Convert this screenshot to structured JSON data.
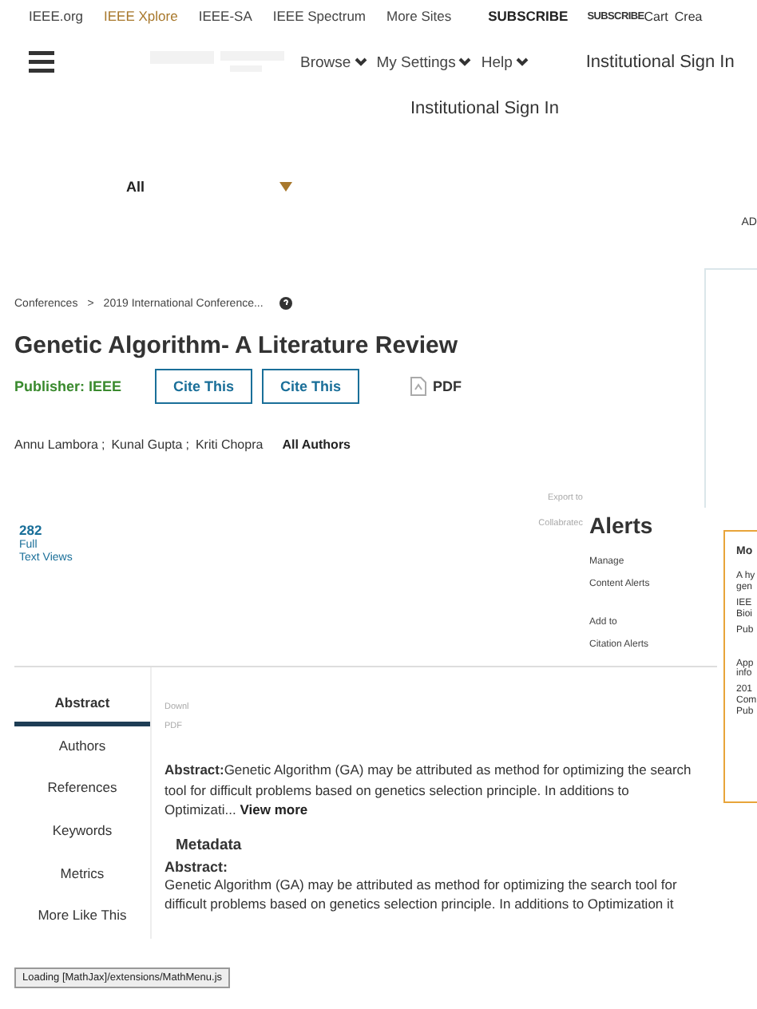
{
  "top_links": [
    {
      "label": "IEEE.org",
      "selected": false
    },
    {
      "label": "IEEE Xplore",
      "selected": true
    },
    {
      "label": "IEEE-SA",
      "selected": false
    },
    {
      "label": "IEEE Spectrum",
      "selected": false
    },
    {
      "label": "More Sites",
      "selected": false
    }
  ],
  "subscribe": "SUBSCRIBE",
  "top_right": [
    "SUBSCRIBE",
    "Cart",
    "Crea"
  ],
  "nav_menus": [
    "Browse",
    "My Settings",
    "Help"
  ],
  "sign_in": "Institutional Sign In",
  "sign_in_second": "Institutional Sign In",
  "search_scope": "All",
  "ad_label": "AD",
  "breadcrumbs": [
    "Conferences",
    "2019 International Conference..."
  ],
  "breadcrumb_separator": ">",
  "title": "Genetic Algorithm- A Literature Review",
  "publisher": "Publisher:  IEEE",
  "cite_buttons": [
    "Cite This",
    "Cite This"
  ],
  "pdf": "PDF",
  "authors": [
    "Annu Lambora",
    "Kunal Gupta",
    "Kriti Chopra"
  ],
  "author_separator": ";",
  "all_authors": "All Authors",
  "views": {
    "count": "282",
    "label_1": "Full",
    "label_2": "Text Views"
  },
  "export": [
    "Export to",
    "Collabratec"
  ],
  "alerts": {
    "title": "Alerts",
    "items": [
      "Manage",
      "Content Alerts",
      "Add to",
      "Citation Alerts"
    ]
  },
  "side_card": {
    "title": "Mo",
    "lines": [
      "A hy",
      "gen",
      "IEE",
      "Bioi",
      "Pub",
      "App",
      "info",
      "201",
      "Com",
      "Pub"
    ]
  },
  "tabs": [
    {
      "label": "Abstract",
      "selected": true
    },
    {
      "label": "Authors",
      "selected": false
    },
    {
      "label": "References",
      "selected": false
    },
    {
      "label": "Keywords",
      "selected": false
    },
    {
      "label": "Metrics",
      "selected": false
    },
    {
      "label": "More Like This",
      "selected": false
    }
  ],
  "download": [
    "Downl",
    "PDF"
  ],
  "abstract_teaser": "**Abstract:**Genetic Algorithm (GA) may be attributed as method for optimizing the search tool for difficult problems based on genetics selection principle. In additions to Optimizati...",
  "view_more": "View more",
  "metadata_heading": "Metadata",
  "abstract_heading": "Abstract:",
  "abstract_body": "Genetic Algorithm (GA) may be attributed as method for optimizing the search tool for difficult problems based on genetics selection principle. In additions to Optimization it",
  "loading": "Loading [MathJax]/extensions/MathMenu.js"
}
